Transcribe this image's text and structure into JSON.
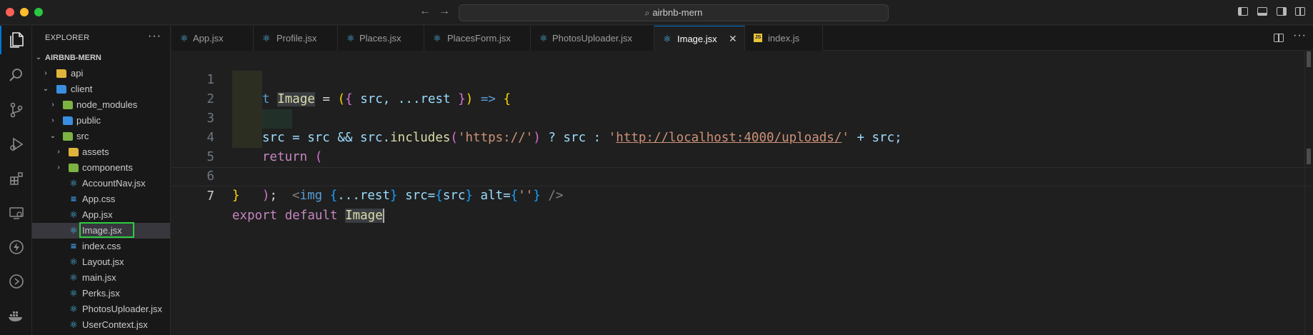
{
  "window": {
    "search_text": "airbnb-mern"
  },
  "sidebar": {
    "title": "EXPLORER",
    "more": "···",
    "root": "AIRBNB-MERN",
    "items": [
      {
        "label": "api"
      },
      {
        "label": "client"
      },
      {
        "label": "node_modules"
      },
      {
        "label": "public"
      },
      {
        "label": "src"
      },
      {
        "label": "assets"
      },
      {
        "label": "components"
      },
      {
        "label": "AccountNav.jsx"
      },
      {
        "label": "App.css"
      },
      {
        "label": "App.jsx"
      },
      {
        "label": "Image.jsx"
      },
      {
        "label": "index.css"
      },
      {
        "label": "Layout.jsx"
      },
      {
        "label": "main.jsx"
      },
      {
        "label": "Perks.jsx"
      },
      {
        "label": "PhotosUploader.jsx"
      },
      {
        "label": "UserContext.jsx"
      }
    ]
  },
  "tabs": [
    {
      "label": "App.jsx"
    },
    {
      "label": "Profile.jsx"
    },
    {
      "label": "Places.jsx"
    },
    {
      "label": "PlacesForm.jsx"
    },
    {
      "label": "PhotosUploader.jsx"
    },
    {
      "label": "Image.jsx"
    },
    {
      "label": "index.js"
    }
  ],
  "editor": {
    "line_numbers": [
      "1",
      "2",
      "3",
      "4",
      "5",
      "6",
      "7"
    ],
    "lines": {
      "l1": [
        "const",
        "Image",
        "=",
        "(",
        "{",
        "src, ...rest",
        "}",
        ")",
        "=>",
        "{"
      ],
      "l2": [
        "src = src && src.",
        "includes",
        "(",
        "'https://'",
        ")",
        "? src :",
        "'",
        "http://localhost:4000/uploads/",
        "'",
        "+ src;"
      ],
      "l3": [
        "return",
        "("
      ],
      "l4": [
        "<",
        "img",
        "{",
        "...rest",
        "}",
        "src=",
        "{",
        "src",
        "}",
        "alt=",
        "{",
        "''",
        "}",
        "/>"
      ],
      "l5": [
        ")",
        ";"
      ],
      "l6": [
        "}"
      ],
      "l7": [
        "export",
        "default",
        "Image"
      ]
    }
  },
  "colors": {
    "accent": "#0078d4",
    "highlight_box": "#2ecc40"
  }
}
